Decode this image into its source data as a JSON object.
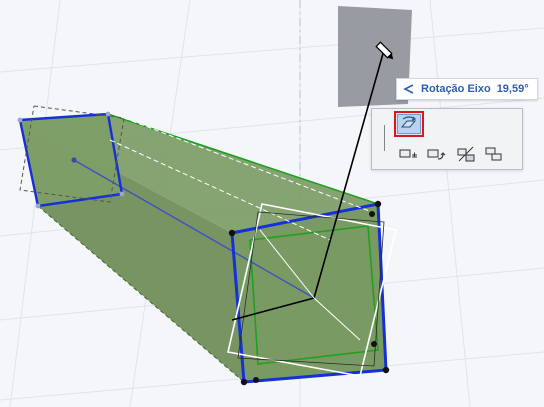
{
  "tooltip": {
    "label": "Rotação Eixo",
    "value": "19,59°",
    "icon": "angle-arrow-icon"
  },
  "palette": {
    "buttons": [
      {
        "name": "rotate-axis-button",
        "icon": "rotate-axis-icon",
        "active": true
      },
      {
        "name": "move-button",
        "icon": "move-icon",
        "active": false
      },
      {
        "name": "rotate-button",
        "icon": "rotate-icon",
        "active": false
      },
      {
        "name": "mirror-button",
        "icon": "mirror-icon",
        "active": false
      },
      {
        "name": "multiply-button",
        "icon": "multiply-icon",
        "active": false
      }
    ]
  },
  "colors": {
    "background": "#f4f6f9",
    "beam_fill": "#6f9256",
    "beam_edge": "#20a020",
    "selection_edge": "#1530d8",
    "axis_line": "#4050c0",
    "highlight_border": "#e0151b",
    "label_text": "#2a5fb0",
    "plane": "#8f9198"
  }
}
